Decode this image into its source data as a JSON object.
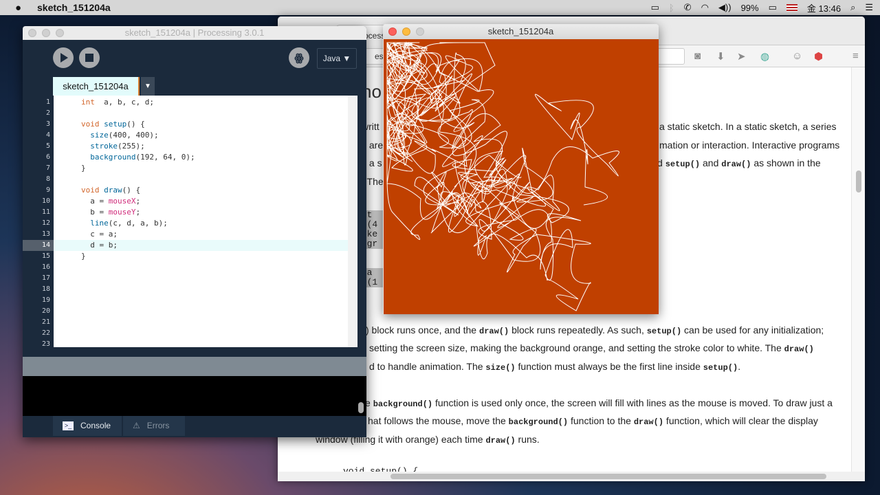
{
  "menubar": {
    "app": "sketch_151204a",
    "battery": "99%",
    "clock": "金 13:46"
  },
  "browser": {
    "tab_fragment": "ocess",
    "url_fragment": "essin",
    "heading_fragment": "no",
    "left_fragments": [
      "writt",
      "s are",
      "s a s",
      ". The"
    ],
    "right_lines": [
      "a static sketch. In a static sketch, a series",
      "mation or interaction. Interactive programs"
    ],
    "line3": {
      "pre": "d ",
      "c1": "setup()",
      "mid": " and ",
      "c2": "draw()",
      "post": " as shown in the"
    },
    "codebox1": [
      " set",
      "ze(4",
      "roke",
      "ckgr"
    ],
    "codebox2": [
      " dra",
      "ne(1"
    ],
    "p1": {
      "a": ") block runs once, and the ",
      "b": "draw()",
      "c": " block runs repeatedly. As such, ",
      "d": "setup()",
      "e": " can be used for any initialization;"
    },
    "p2": {
      "a": "setting the screen size, making the background orange, and setting the stroke color to white. The ",
      "b": "draw()"
    },
    "p3": {
      "a": "d to handle animation. The ",
      "b": "size()",
      "c": " function must always be the first line inside ",
      "d": "setup()",
      "e": "."
    },
    "p4": {
      "a": "e ",
      "b": "background()",
      "c": " function is used only once, the screen will fill with lines as the mouse is moved. To draw just a"
    },
    "p5": {
      "a": "hat follows the mouse, move the ",
      "b": "background()",
      "c": " function to the ",
      "d": "draw()",
      "e": " function, which will clear the display"
    },
    "p6": {
      "a": "window (filling it with orange) each time ",
      "b": "draw()",
      "c": " runs."
    },
    "code_tail": "void setup() {"
  },
  "pde": {
    "title": "sketch_151204a | Processing 3.0.1",
    "mode": "Java ▼",
    "tab": "sketch_151204a",
    "tab_menu": "▼",
    "console_tab": "Console",
    "errors_tab": "Errors",
    "current_line": 14,
    "lines": [
      [
        [
          "kw",
          "int"
        ],
        [
          "",
          "  a, b, c, d;"
        ]
      ],
      [],
      [
        [
          "kw",
          "void "
        ],
        [
          "fn",
          "setup"
        ],
        [
          "",
          "() {"
        ]
      ],
      [
        [
          "",
          "  "
        ],
        [
          "fn",
          "size"
        ],
        [
          "",
          "(400, 400);"
        ]
      ],
      [
        [
          "",
          "  "
        ],
        [
          "fn",
          "stroke"
        ],
        [
          "",
          "(255);"
        ]
      ],
      [
        [
          "",
          "  "
        ],
        [
          "fn",
          "background"
        ],
        [
          "",
          "(192, 64, 0);"
        ]
      ],
      [
        [
          "",
          "}"
        ]
      ],
      [],
      [
        [
          "kw",
          "void "
        ],
        [
          "fn",
          "draw"
        ],
        [
          "",
          "() {"
        ]
      ],
      [
        [
          "",
          "  a = "
        ],
        [
          "vr",
          "mouseX"
        ],
        [
          "",
          ";"
        ]
      ],
      [
        [
          "",
          "  b = "
        ],
        [
          "vr",
          "mouseY"
        ],
        [
          "",
          ";"
        ]
      ],
      [
        [
          "",
          "  "
        ],
        [
          "fn",
          "line"
        ],
        [
          "",
          "(c, d, a, b);"
        ]
      ],
      [
        [
          "",
          "  c = a;"
        ]
      ],
      [
        [
          "",
          "  d = b;"
        ]
      ],
      [
        [
          "",
          "}"
        ]
      ],
      [],
      [],
      [],
      [],
      [],
      [],
      [],
      []
    ]
  },
  "sketch": {
    "title": "sketch_151204a",
    "bg": "#c04000",
    "stroke": "#ffffff"
  }
}
